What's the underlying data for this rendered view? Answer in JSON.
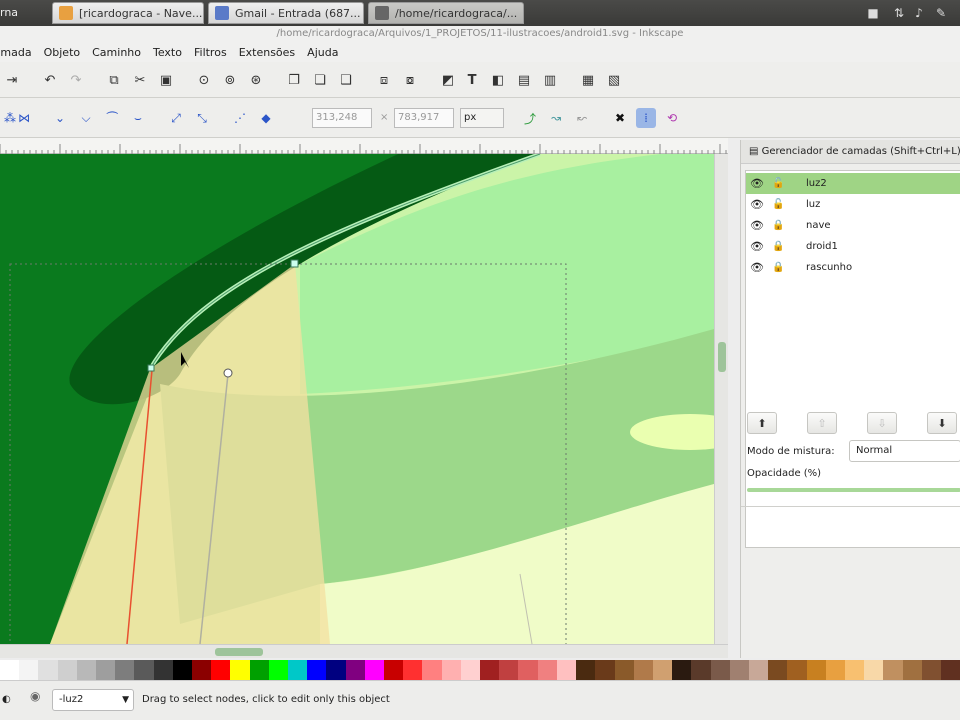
{
  "system_bar": {
    "app_name": "rna",
    "tabs": [
      {
        "label": "[ricardograca - Nave..."
      },
      {
        "label": "Gmail - Entrada (687..."
      },
      {
        "label": "/home/ricardograca/..."
      }
    ]
  },
  "window": {
    "title": "/home/ricardograca/Arquivos/1_PROJETOS/11-ilustracoes/android1.svg - Inkscape"
  },
  "menu": [
    "Camada",
    "Objeto",
    "Caminho",
    "Texto",
    "Filtros",
    "Extensões",
    "Ajuda"
  ],
  "controls": {
    "x_value": "313,248",
    "y_value": "783,917",
    "unit": "px"
  },
  "layers_panel": {
    "title": "Gerenciador de camadas (Shift+Ctrl+L)",
    "layers": [
      {
        "name": "luz2",
        "selected": true
      },
      {
        "name": "luz",
        "selected": false
      },
      {
        "name": "nave",
        "selected": false
      },
      {
        "name": "droid1",
        "selected": false
      },
      {
        "name": "rascunho",
        "selected": false
      }
    ],
    "blend_label": "Modo de mistura:",
    "blend_value": "Normal",
    "opacity_label": "Opacidade (%)"
  },
  "status": {
    "current_layer": "-luz2",
    "message": "Drag to select nodes, click to edit only this object"
  },
  "palette": [
    "#ffffff",
    "#f4f4f4",
    "#e0e0e0",
    "#cfcfcf",
    "#b8b8b8",
    "#9e9e9e",
    "#7d7d7d",
    "#5a5a5a",
    "#333333",
    "#000000",
    "#8b0000",
    "#ff0000",
    "#ffff00",
    "#00a000",
    "#00ff00",
    "#00c8c8",
    "#0000ff",
    "#000080",
    "#800080",
    "#ff00ff",
    "#c80000",
    "#ff3030",
    "#ff8080",
    "#ffb0b0",
    "#ffd0d0",
    "#a02020",
    "#c04040",
    "#e06060",
    "#f08080",
    "#ffc0c0",
    "#4a2a10",
    "#6a3a1a",
    "#8a5a2a",
    "#b07a4a",
    "#d0a070",
    "#2a1a10",
    "#5a3a2a",
    "#7a5a4a",
    "#a08070",
    "#c8a898",
    "#7a4a20",
    "#a06020",
    "#c88020",
    "#e8a040",
    "#f8c070",
    "#f8d8a8",
    "#c09060",
    "#a07040",
    "#805030",
    "#603020"
  ],
  "colors": {
    "canvas_dark": "#0a7a1e",
    "layer_selected": "#9fd485"
  }
}
